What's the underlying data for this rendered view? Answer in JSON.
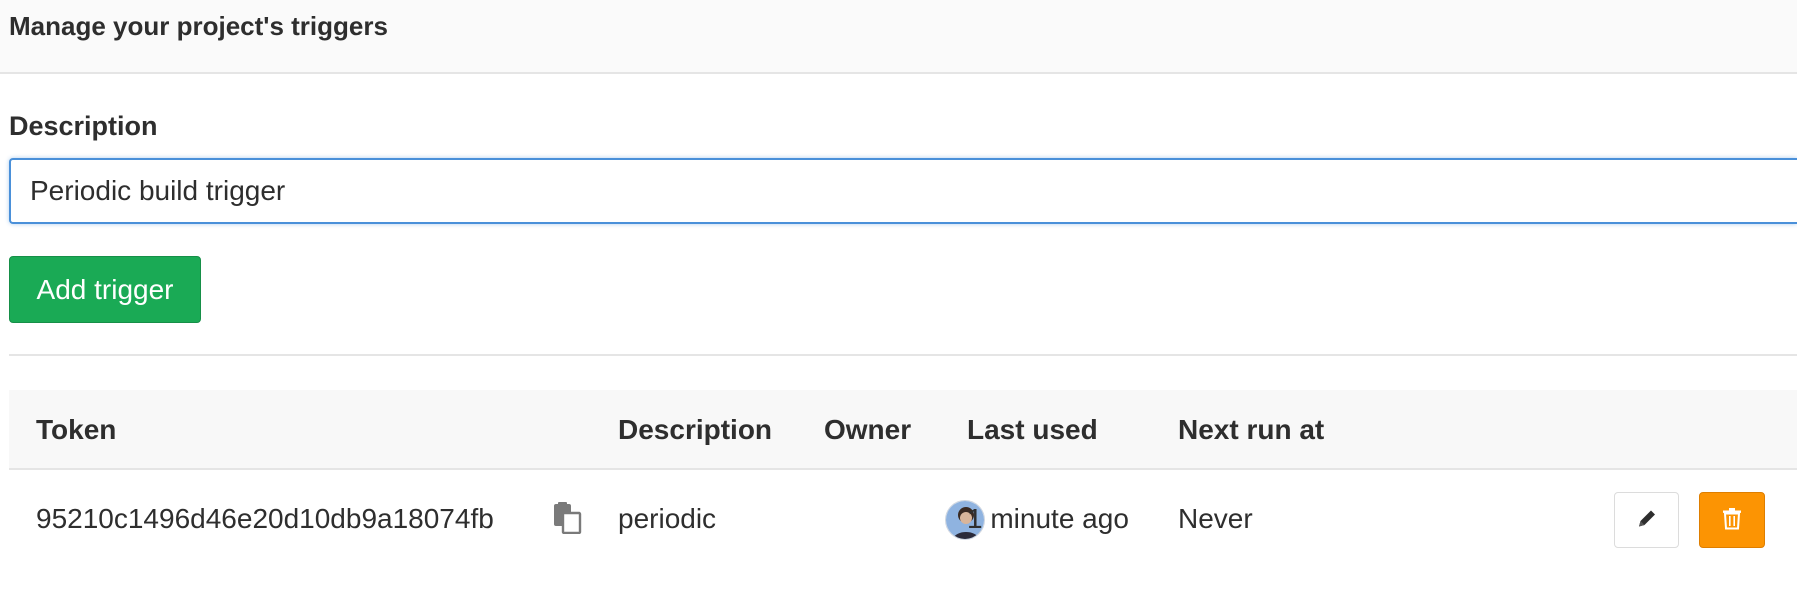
{
  "header": {
    "title": "Manage your project's triggers"
  },
  "form": {
    "description_label": "Description",
    "description_value": "Periodic build trigger",
    "submit_label": "Add trigger"
  },
  "table": {
    "columns": [
      "Token",
      "Description",
      "Owner",
      "Last used",
      "Next run at"
    ],
    "rows": [
      {
        "token": "95210c1496d46e20d10db9a18074fb",
        "description": "periodic",
        "owner_icon": "user-avatar",
        "last_used": "1 minute ago",
        "next_run_at": "Never"
      }
    ]
  },
  "icons": {
    "copy": "copy-to-clipboard-icon",
    "edit": "pencil-icon",
    "delete": "trash-icon"
  },
  "colors": {
    "primary_green": "#1aaa55",
    "warning_orange": "#fc9403",
    "focus_blue": "#4a90d9"
  }
}
